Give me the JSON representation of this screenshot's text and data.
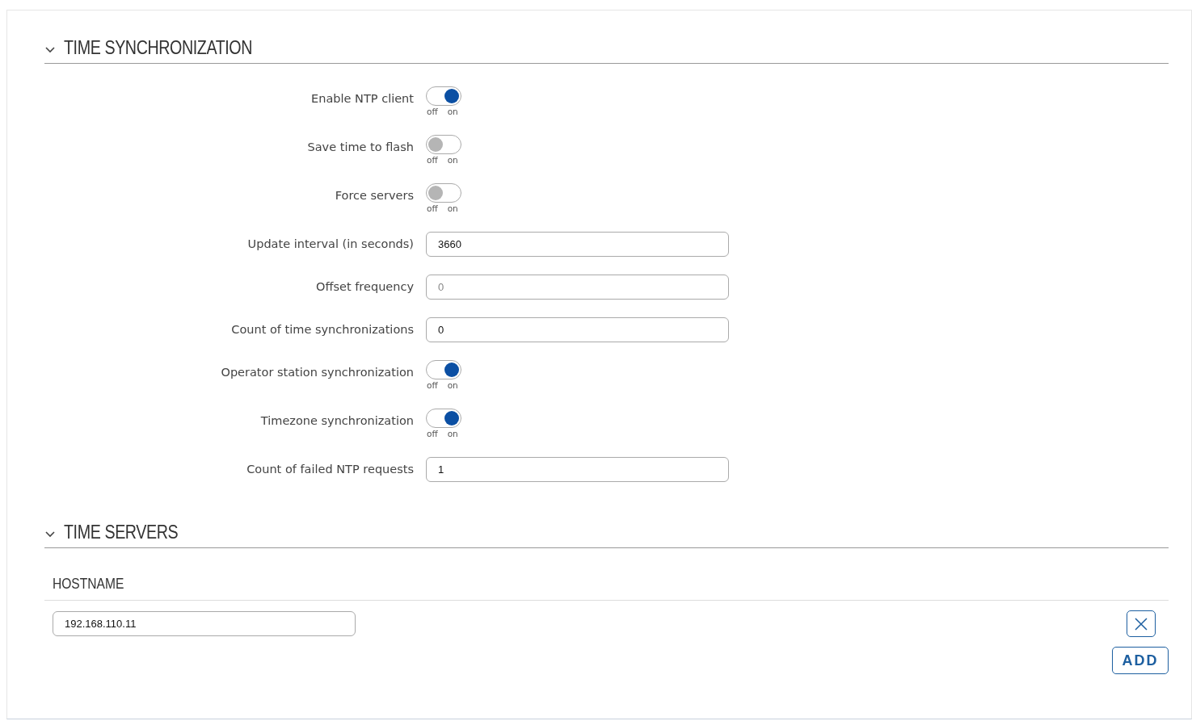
{
  "sections": [
    {
      "title": "TIME SYNCHRONIZATION",
      "expanded": true,
      "fields": [
        {
          "kind": "toggle",
          "label": "Enable NTP client",
          "on": true,
          "off_label": "off",
          "on_label": "on"
        },
        {
          "kind": "toggle",
          "label": "Save time to flash",
          "on": false,
          "off_label": "off",
          "on_label": "on"
        },
        {
          "kind": "toggle",
          "label": "Force servers",
          "on": false,
          "off_label": "off",
          "on_label": "on"
        },
        {
          "kind": "input",
          "label": "Update interval (in seconds)",
          "value": "3660"
        },
        {
          "kind": "input",
          "label": "Offset frequency",
          "placeholder": "0"
        },
        {
          "kind": "input",
          "label": "Count of time synchronizations",
          "value": "0"
        },
        {
          "kind": "toggle",
          "label": "Operator station synchronization",
          "on": true,
          "off_label": "off",
          "on_label": "on"
        },
        {
          "kind": "toggle",
          "label": "Timezone synchronization",
          "on": true,
          "off_label": "off",
          "on_label": "on"
        },
        {
          "kind": "input",
          "label": "Count of failed NTP requests",
          "value": "1"
        }
      ]
    },
    {
      "title": "TIME SERVERS",
      "expanded": true,
      "table": {
        "columns": [
          "HOSTNAME"
        ],
        "rows": [
          {
            "hostname": "192.168.110.11"
          }
        ],
        "add_button": "ADD"
      }
    }
  ]
}
